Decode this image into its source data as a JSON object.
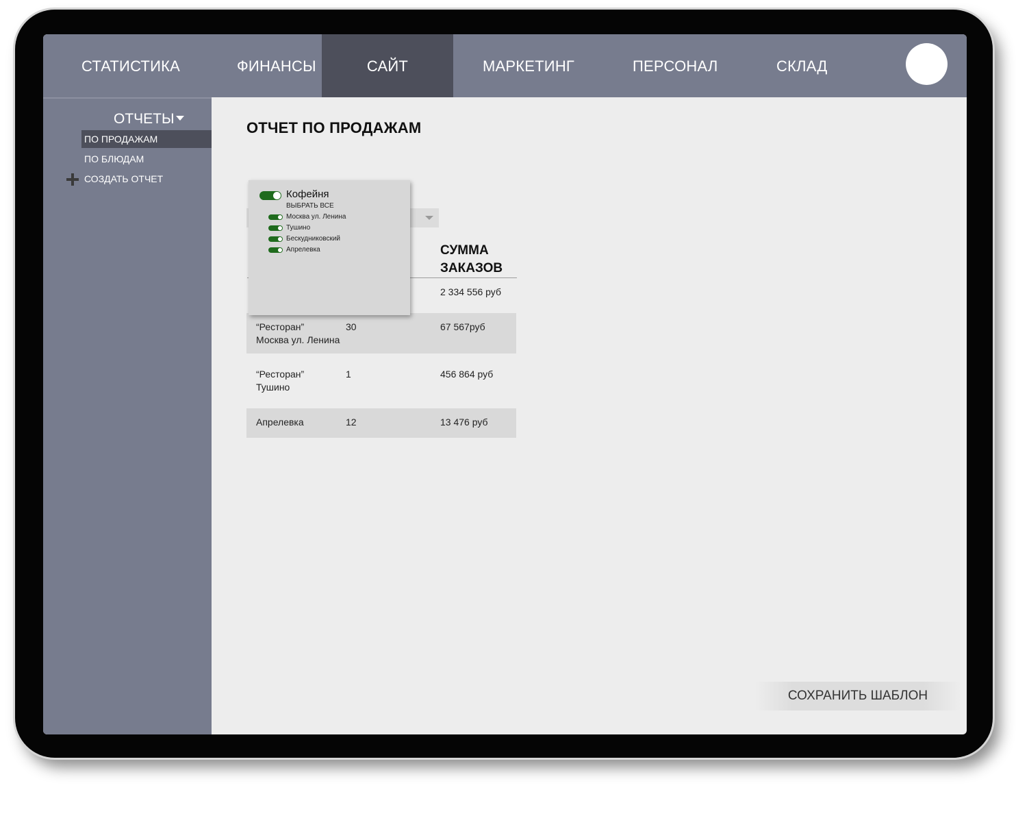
{
  "nav": {
    "tabs": [
      {
        "label": "СТАТИСТИКА"
      },
      {
        "label": "ФИНАНСЫ"
      },
      {
        "label": "САЙТ"
      },
      {
        "label": "МАРКЕТИНГ"
      },
      {
        "label": "ПЕРСОНАЛ"
      },
      {
        "label": "СКЛАД"
      }
    ],
    "active_tab": "САЙТ"
  },
  "sidebar": {
    "section_label": "ОТЧЕТЫ",
    "items": [
      {
        "label": "ПО ПРОДАЖАМ"
      },
      {
        "label": "ПО БЛЮДАМ"
      }
    ],
    "active_item": "ПО ПРОДАЖАМ",
    "create_label": "СОЗДАТЬ ОТЧЕТ"
  },
  "main": {
    "title": "ОТЧЕТ ПО ПРОДАЖАМ",
    "table": {
      "column_header": "СУММА\nЗАКАЗОВ",
      "rows": [
        {
          "name": "",
          "count": "",
          "sum": "2 334 556 руб"
        },
        {
          "name": "“Ресторан”\nМосква ул. Ленина",
          "count": "30",
          "sum": "67 567руб"
        },
        {
          "name": "“Ресторан”\nТушино",
          "count": "1",
          "sum": "456 864 руб"
        },
        {
          "name": "Апрелевка",
          "count": "12",
          "sum": "13 476 руб"
        }
      ]
    },
    "filter_popup": {
      "title": "Кофейня",
      "select_all": "ВЫБРАТЬ ВСЕ",
      "items": [
        {
          "label": "Москва ул. Ленина",
          "enabled": true
        },
        {
          "label": "Тушино",
          "enabled": true
        },
        {
          "label": "Бескудниковский",
          "enabled": true
        },
        {
          "label": "Апрелевка",
          "enabled": true
        }
      ],
      "title_enabled": true
    },
    "save_button": "СОХРАНИТЬ ШАБЛОН"
  },
  "colors": {
    "nav_bg": "#777c8e",
    "nav_active": "#4d4f5b",
    "content_bg": "#ededed",
    "toggle_on": "#1f6b1d"
  }
}
